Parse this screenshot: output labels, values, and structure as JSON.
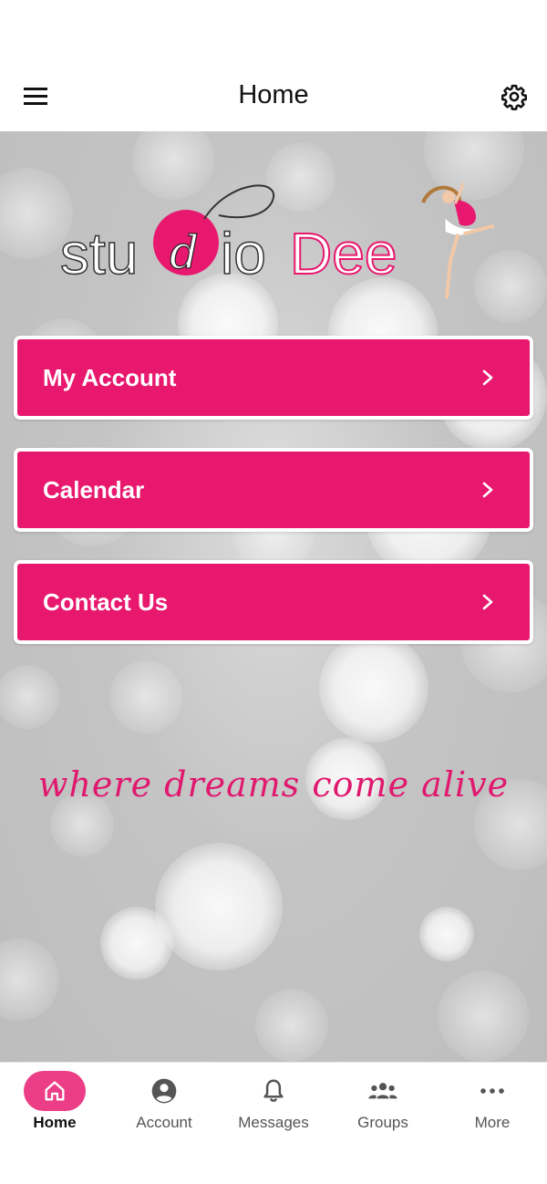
{
  "topbar": {
    "title": "Home",
    "menu_icon": "hamburger-menu-icon",
    "settings_icon": "gear-icon"
  },
  "logo": {
    "text_part1": "stu",
    "text_d": "d",
    "text_part2": "io",
    "text_part3": "Dee",
    "accent_color": "#e8186f"
  },
  "menu": {
    "items": [
      {
        "label": "My Account"
      },
      {
        "label": "Calendar"
      },
      {
        "label": "Contact Us"
      }
    ],
    "button_color": "#e8186f"
  },
  "tagline": "where dreams come alive",
  "bottom_nav": {
    "items": [
      {
        "label": "Home",
        "icon": "home-icon",
        "active": true
      },
      {
        "label": "Account",
        "icon": "account-circle-icon",
        "active": false
      },
      {
        "label": "Messages",
        "icon": "bell-icon",
        "active": false
      },
      {
        "label": "Groups",
        "icon": "groups-icon",
        "active": false
      },
      {
        "label": "More",
        "icon": "more-dots-icon",
        "active": false
      }
    ],
    "active_color": "#ec3e86"
  }
}
